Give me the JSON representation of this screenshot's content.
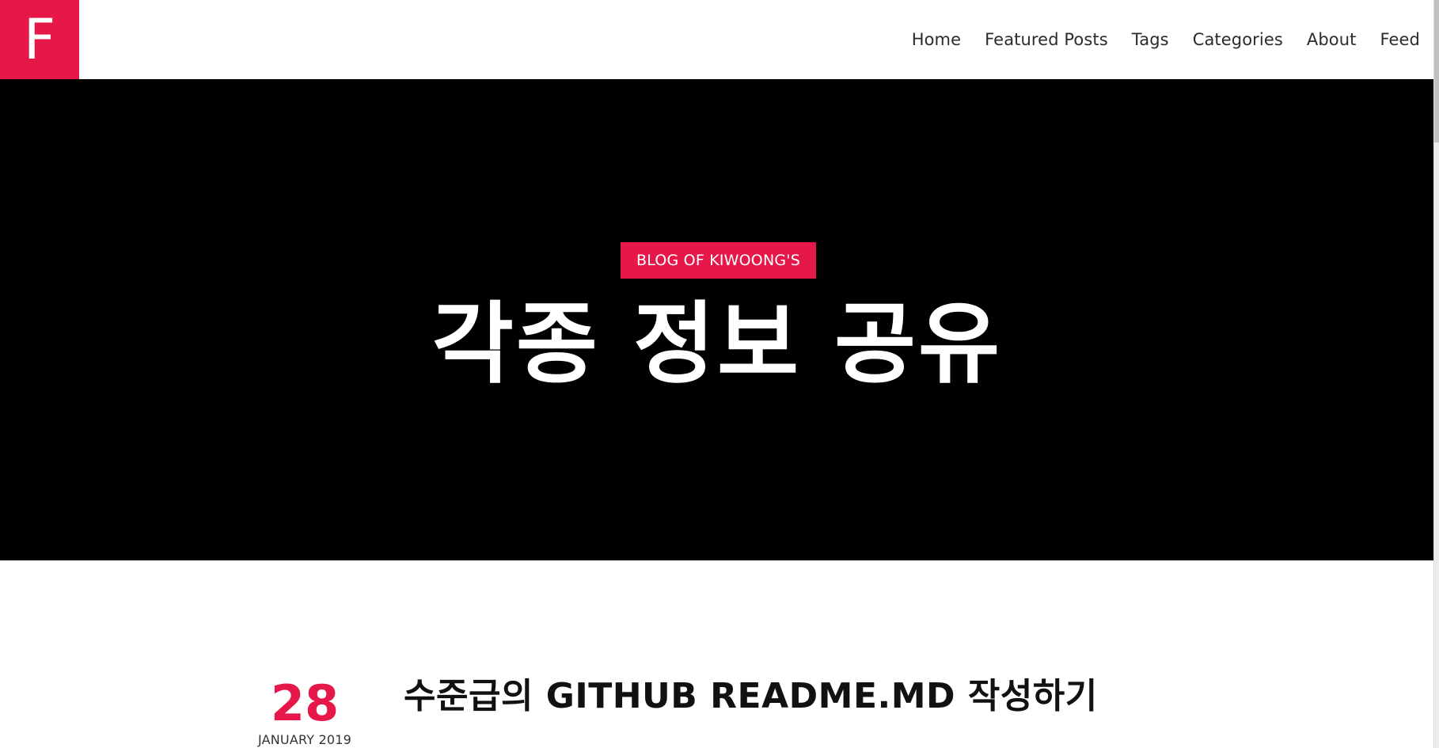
{
  "colors": {
    "accent": "#e6184a",
    "hero_background": "#000000",
    "page_background": "#ffffff"
  },
  "header": {
    "logo_letter": "F",
    "nav": {
      "home": "Home",
      "featured_posts": "Featured Posts",
      "tags": "Tags",
      "categories": "Categories",
      "about": "About",
      "feed": "Feed"
    }
  },
  "hero": {
    "badge": "BLOG OF KIWOONG'S",
    "title": "각종 정보 공유"
  },
  "posts": [
    {
      "day": "28",
      "month_year": "JANUARY 2019",
      "title": "수준급의 GITHUB README.MD 작성하기"
    }
  ]
}
